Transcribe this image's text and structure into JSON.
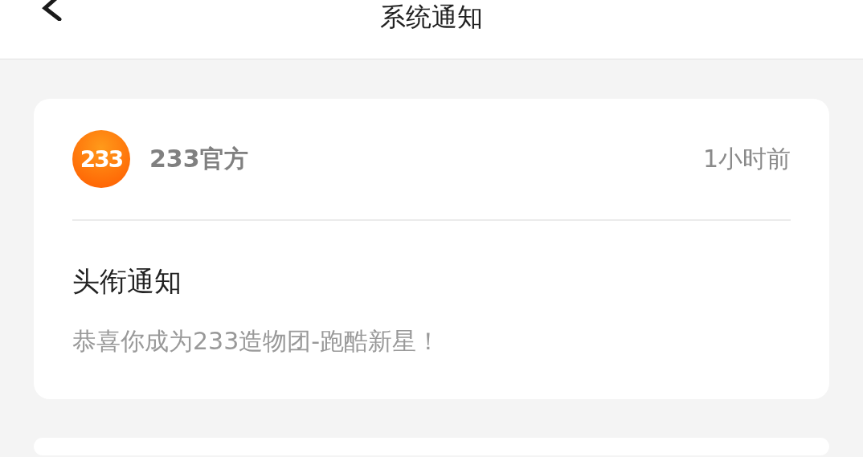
{
  "header": {
    "title": "系统通知"
  },
  "notifications": [
    {
      "sender": "233官方",
      "avatar_text": "233",
      "time": "1小时前",
      "title": "头衔通知",
      "body": "恭喜你成为233造物团-跑酷新星！"
    }
  ],
  "more_cards_below": true
}
